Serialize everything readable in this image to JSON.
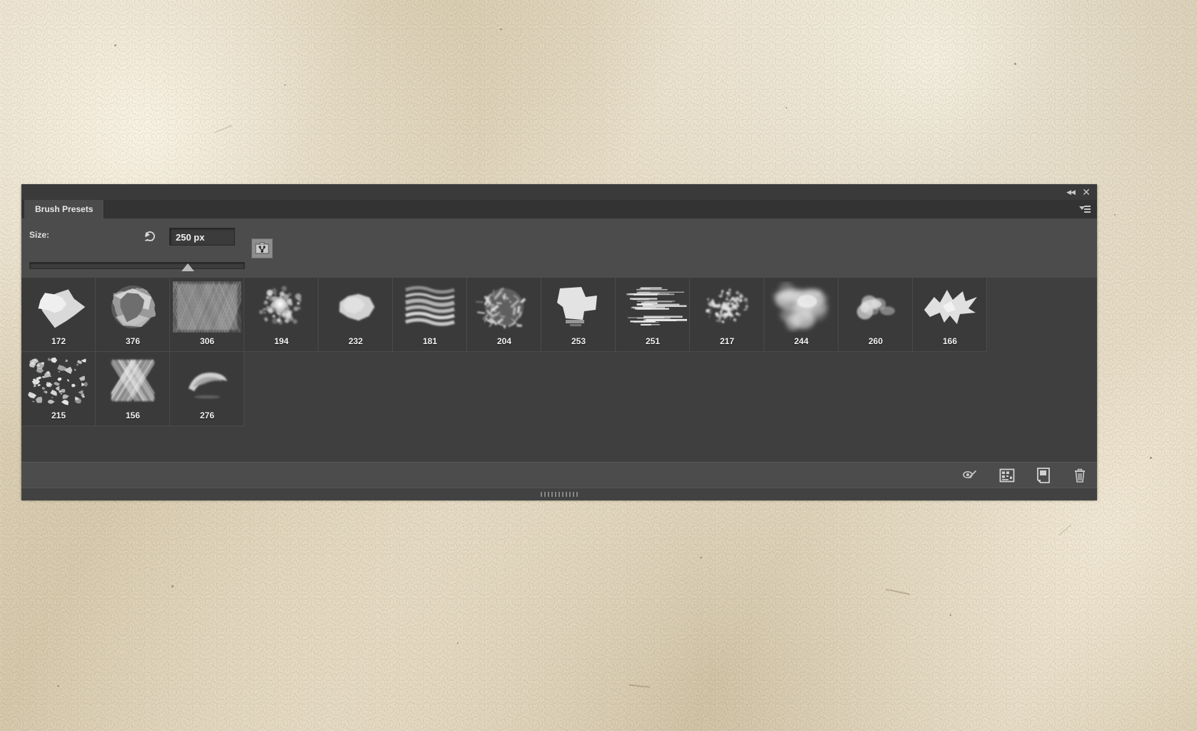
{
  "panel": {
    "titlebar": {
      "collapse_icon": "double-chevron-left-icon",
      "collapse_glyph": "◀◀",
      "close_icon": "close-icon",
      "close_glyph": "✕"
    },
    "tabs": [
      {
        "label": "Brush Presets",
        "active": true
      }
    ],
    "menu_icon": "panel-menu-icon",
    "controls": {
      "size_label": "Size:",
      "size_value": "250 px",
      "size_placeholder": "250 px",
      "reset_icon": "reset-arrow-icon",
      "brush_tip_icon": "brush-tip-settings-icon",
      "slider": {
        "min": 1,
        "max": 2500,
        "value": 250,
        "percent": 74
      }
    },
    "footer": {
      "tools": [
        {
          "name": "toggle-brush-preview-button",
          "icon": "brush-eye-icon"
        },
        {
          "name": "open-preset-manager-button",
          "icon": "preset-manager-grid-icon"
        },
        {
          "name": "create-new-brush-button",
          "icon": "new-page-icon"
        },
        {
          "name": "delete-brush-button",
          "icon": "trash-icon"
        }
      ]
    },
    "resize_grip": "resize-grip"
  },
  "brushes": [
    {
      "size": "172",
      "shape": "chunk"
    },
    {
      "size": "376",
      "shape": "crumple"
    },
    {
      "size": "306",
      "shape": "hatch-grunge"
    },
    {
      "size": "194",
      "shape": "soft-glow"
    },
    {
      "size": "232",
      "shape": "blob"
    },
    {
      "size": "181",
      "shape": "ripple"
    },
    {
      "size": "204",
      "shape": "scratchy"
    },
    {
      "size": "253",
      "shape": "block-splat"
    },
    {
      "size": "251",
      "shape": "streaks"
    },
    {
      "size": "217",
      "shape": "spatter-cloud"
    },
    {
      "size": "244",
      "shape": "smoke"
    },
    {
      "size": "260",
      "shape": "small-cloud"
    },
    {
      "size": "166",
      "shape": "jagged-flake"
    },
    {
      "size": "215",
      "shape": "speckle"
    },
    {
      "size": "156",
      "shape": "crosshatch"
    },
    {
      "size": "276",
      "shape": "curved-smear"
    }
  ]
}
